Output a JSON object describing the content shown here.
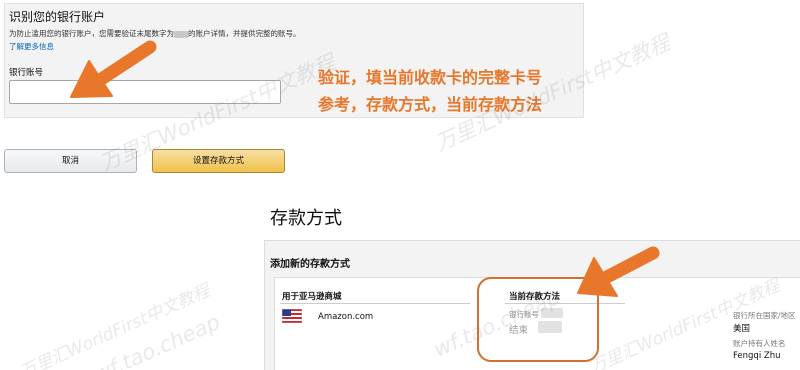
{
  "verify": {
    "title": "识别您的银行账户",
    "desc_before": "为防止滥用您的银行账户，您需要验证末尾数字为",
    "desc_after": "的账户详情，并提供完整的账号。",
    "learn_more": "了解更多信息",
    "account_label": "银行账号",
    "account_value": ""
  },
  "buttons": {
    "cancel": "取消",
    "set_deposit": "设置存款方式"
  },
  "annotation": {
    "line1": "验证，填当前收款卡的完整卡号",
    "line2": "参考，存款方式，当前存款方法"
  },
  "deposit": {
    "title": "存款方式",
    "add_title": "添加新的存款方式",
    "col_marketplace": "用于亚马逊商城",
    "col_current": "当前存款方法",
    "marketplace_name": "Amazon.com",
    "flag_icon": "us-flag-icon",
    "bank_account_label": "银行账号",
    "ending_label": "结束",
    "country_label": "银行所在国家/地区",
    "country_value": "美国",
    "holder_label": "账户持有人姓名",
    "holder_value": "Fengqi Zhu"
  },
  "watermark": {
    "line_a": "万里汇WorldFirst中文教程",
    "line_b": "wf.tao.cheap"
  },
  "colors": {
    "accent_orange": "#e8762b",
    "button_yellow": "#f0c14b",
    "link_blue": "#0066c0"
  }
}
